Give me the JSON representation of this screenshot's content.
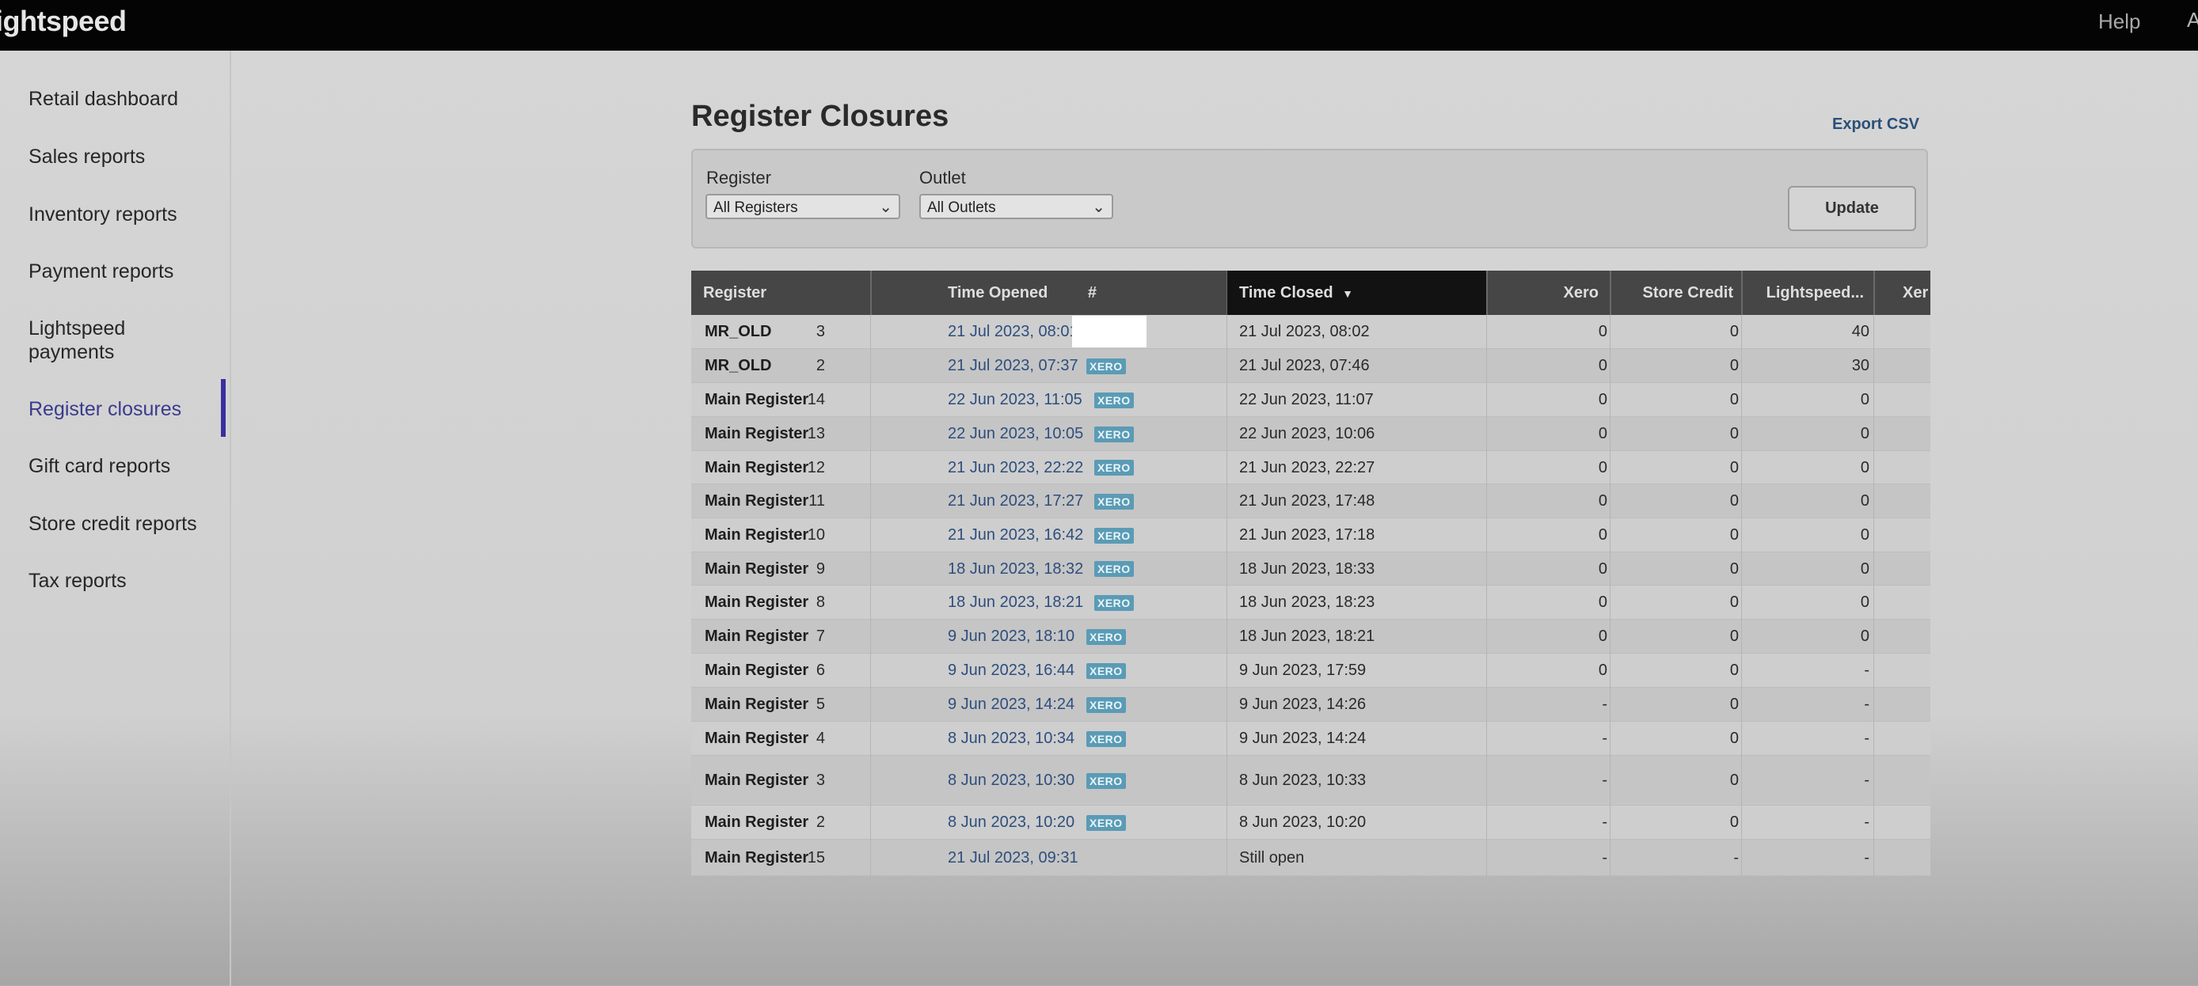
{
  "topbar": {
    "brand": "ightspeed",
    "help": "Help",
    "icon": "A"
  },
  "sidebar": {
    "items": [
      {
        "label": "Retail dashboard",
        "active": false
      },
      {
        "label": "Sales reports",
        "active": false
      },
      {
        "label": "Inventory reports",
        "active": false
      },
      {
        "label": "Payment reports",
        "active": false
      },
      {
        "label": "Lightspeed payments",
        "active": false
      },
      {
        "label": "Register closures",
        "active": true
      },
      {
        "label": "Gift card reports",
        "active": false
      },
      {
        "label": "Store credit reports",
        "active": false
      },
      {
        "label": "Tax reports",
        "active": false
      }
    ]
  },
  "page": {
    "title": "Register Closures",
    "export_label": "Export CSV"
  },
  "filters": {
    "register_label": "Register",
    "register_value": "All Registers",
    "outlet_label": "Outlet",
    "outlet_value": "All Outlets",
    "update_label": "Update"
  },
  "table": {
    "headers": {
      "register": "Register",
      "num": "#",
      "time_opened": "Time Opened",
      "time_closed": "Time Closed",
      "xero": "Xero",
      "store_credit": "Store Credit",
      "lightspeed": "Lightspeed...",
      "xero2": "Xer"
    },
    "sorted_by": "Time Closed",
    "badge_text": "XERO",
    "rows": [
      {
        "register": "MR_OLD",
        "num": "3",
        "opened": "21 Jul 2023, 08:01",
        "closed": "21 Jul 2023, 08:02",
        "xero": "0",
        "store_credit": "0",
        "lightspeed": "40",
        "badge": true
      },
      {
        "register": "MR_OLD",
        "num": "2",
        "opened": "21 Jul 2023, 07:37",
        "closed": "21 Jul 2023, 07:46",
        "xero": "0",
        "store_credit": "0",
        "lightspeed": "30",
        "badge": true
      },
      {
        "register": "Main Register",
        "num": "14",
        "opened": "22 Jun 2023, 11:05",
        "closed": "22 Jun 2023, 11:07",
        "xero": "0",
        "store_credit": "0",
        "lightspeed": "0",
        "badge": true
      },
      {
        "register": "Main Register",
        "num": "13",
        "opened": "22 Jun 2023, 10:05",
        "closed": "22 Jun 2023, 10:06",
        "xero": "0",
        "store_credit": "0",
        "lightspeed": "0",
        "badge": true
      },
      {
        "register": "Main Register",
        "num": "12",
        "opened": "21 Jun 2023, 22:22",
        "closed": "21 Jun 2023, 22:27",
        "xero": "0",
        "store_credit": "0",
        "lightspeed": "0",
        "badge": true
      },
      {
        "register": "Main Register",
        "num": "11",
        "opened": "21 Jun 2023, 17:27",
        "closed": "21 Jun 2023, 17:48",
        "xero": "0",
        "store_credit": "0",
        "lightspeed": "0",
        "badge": true
      },
      {
        "register": "Main Register",
        "num": "10",
        "opened": "21 Jun 2023, 16:42",
        "closed": "21 Jun 2023, 17:18",
        "xero": "0",
        "store_credit": "0",
        "lightspeed": "0",
        "badge": true
      },
      {
        "register": "Main Register",
        "num": "9",
        "opened": "18 Jun 2023, 18:32",
        "closed": "18 Jun 2023, 18:33",
        "xero": "0",
        "store_credit": "0",
        "lightspeed": "0",
        "badge": true
      },
      {
        "register": "Main Register",
        "num": "8",
        "opened": "18 Jun 2023, 18:21",
        "closed": "18 Jun 2023, 18:23",
        "xero": "0",
        "store_credit": "0",
        "lightspeed": "0",
        "badge": true
      },
      {
        "register": "Main Register",
        "num": "7",
        "opened": "9 Jun 2023, 18:10",
        "closed": "18 Jun 2023, 18:21",
        "xero": "0",
        "store_credit": "0",
        "lightspeed": "0",
        "badge": true
      },
      {
        "register": "Main Register",
        "num": "6",
        "opened": "9 Jun 2023, 16:44",
        "closed": "9 Jun 2023, 17:59",
        "xero": "0",
        "store_credit": "0",
        "lightspeed": "-",
        "badge": true
      },
      {
        "register": "Main Register",
        "num": "5",
        "opened": "9 Jun 2023, 14:24",
        "closed": "9 Jun 2023, 14:26",
        "xero": "-",
        "store_credit": "0",
        "lightspeed": "-",
        "badge": true
      },
      {
        "register": "Main Register",
        "num": "4",
        "opened": "8 Jun 2023, 10:34",
        "closed": "9 Jun 2023, 14:24",
        "xero": "-",
        "store_credit": "0",
        "lightspeed": "-",
        "badge": true
      },
      {
        "register": "Main Register",
        "num": "3",
        "opened": "8 Jun 2023, 10:30",
        "closed": "8 Jun 2023, 10:33",
        "xero": "-",
        "store_credit": "0",
        "lightspeed": "-",
        "badge": true
      },
      {
        "register": "Main Register",
        "num": "2",
        "opened": "8 Jun 2023, 10:20",
        "closed": "8 Jun 2023, 10:20",
        "xero": "-",
        "store_credit": "0",
        "lightspeed": "-",
        "badge": true
      },
      {
        "register": "Main Register",
        "num": "15",
        "opened": "21 Jul 2023, 09:31",
        "closed": "Still open",
        "xero": "-",
        "store_credit": "-",
        "lightspeed": "-",
        "badge": false
      }
    ]
  },
  "colors": {
    "accent": "#3a2ea3",
    "link": "#2d4e7e",
    "badge": "#5b9bb5",
    "header": "#464646"
  }
}
